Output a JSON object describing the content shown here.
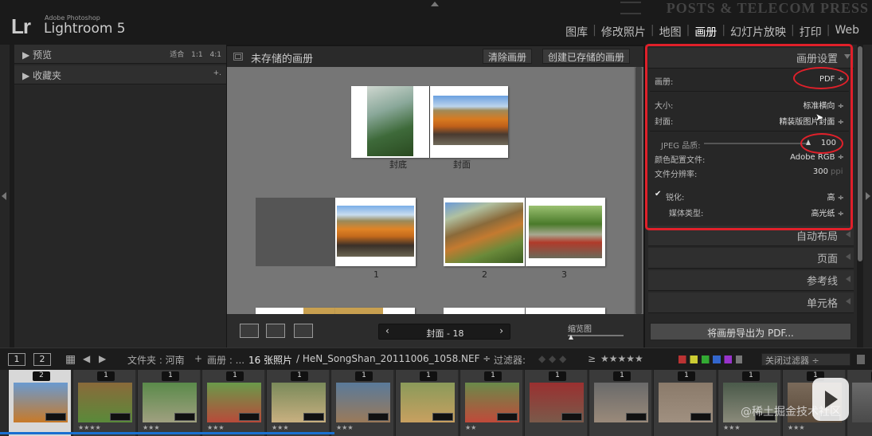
{
  "app": {
    "logo": "Lr",
    "vendor": "Adobe Photoshop",
    "name": "Lightroom 5",
    "watermark_top": "POSTS & TELECOM PRESS"
  },
  "modules": [
    "图库",
    "修改照片",
    "地图",
    "画册",
    "幻灯片放映",
    "打印",
    "Web"
  ],
  "active_module": "画册",
  "left_panel": {
    "preview": {
      "label": "预览",
      "zoom_options": [
        "适合",
        "1:1",
        "4:1"
      ]
    },
    "collections": {
      "label": "收藏夹",
      "action": "+."
    }
  },
  "center": {
    "title": "未存储的画册",
    "clear_button": "清除画册",
    "create_button": "创建已存储的画册",
    "spread_labels": {
      "back": "封底",
      "front": "封面",
      "p1": "1",
      "p2": "2",
      "p3": "3"
    },
    "page_nav_label": "封面 - 18",
    "zoom_label": "缩览图"
  },
  "right_panel": {
    "book_settings": {
      "title": "画册设置",
      "book_label": "画册:",
      "book_value": "PDF ÷",
      "size_label": "大小:",
      "size_value": "标准横向 ÷",
      "cover_label": "封面:",
      "cover_value": "精装版图片封面 ÷",
      "jpeg_label": "JPEG 品质:",
      "jpeg_value": "100",
      "jpeg_quality": 100,
      "color_profile_label": "颜色配置文件:",
      "color_profile_value": "Adobe RGB ÷",
      "resolution_label": "文件分辨率:",
      "resolution_value": "300",
      "resolution_unit": "ppi",
      "sharpen_label": "锐化:",
      "sharpen_value": "高 ÷",
      "media_label": "媒体类型:",
      "media_value": "高光纸 ÷"
    },
    "sections": [
      "自动布局",
      "页面",
      "参考线",
      "单元格"
    ],
    "export_button": "将画册导出为 PDF..."
  },
  "filmstrip_bar": {
    "view1": "1",
    "view2": "2",
    "folder_label": "文件夹 : 河南",
    "book_label": "画册 : ...",
    "count": "16 张照片",
    "filename": "/ HeN_SongShan_20111006_1058.NEF ÷",
    "filter_label": "过滤器:",
    "filter_stars": "★★★★★",
    "filter_value": "关闭过滤器 ÷"
  },
  "filmstrip": [
    {
      "num": "2",
      "dots": "",
      "colors": [
        "#6a9ad0",
        "#c87a28"
      ]
    },
    {
      "num": "1",
      "dots": "★★★★",
      "colors": [
        "#8a6a3a",
        "#5a8a3a"
      ]
    },
    {
      "num": "1",
      "dots": "★★★",
      "colors": [
        "#5a8a4a",
        "#a0a080"
      ]
    },
    {
      "num": "1",
      "dots": "★★★",
      "colors": [
        "#6a9a4a",
        "#b84a3a"
      ]
    },
    {
      "num": "1",
      "dots": "★★★",
      "colors": [
        "#7a8a5a",
        "#c8b080"
      ]
    },
    {
      "num": "1",
      "dots": "★★★",
      "colors": [
        "#5a7a9a",
        "#9a7a5a"
      ]
    },
    {
      "num": "1",
      "dots": "",
      "colors": [
        "#8a9a5a",
        "#c8a060"
      ]
    },
    {
      "num": "1",
      "dots": "★★",
      "colors": [
        "#6a8a4a",
        "#c04a3a"
      ]
    },
    {
      "num": "1",
      "dots": "",
      "colors": [
        "#9a3030",
        "#7a5a4a"
      ]
    },
    {
      "num": "1",
      "dots": "",
      "colors": [
        "#6a6a6a",
        "#9a8a7a"
      ]
    },
    {
      "num": "1",
      "dots": "",
      "colors": [
        "#8a7a6a",
        "#a09080"
      ]
    },
    {
      "num": "1",
      "dots": "★★★",
      "colors": [
        "#4a5a4a",
        "#8a8a7a"
      ]
    },
    {
      "num": "1",
      "dots": "★★★",
      "colors": [
        "#7a6a5a",
        "#5a4a3a"
      ]
    },
    {
      "num": "1",
      "dots": "",
      "colors": [
        "#6a6a6a",
        "#4a4a4a"
      ]
    }
  ],
  "watermark_bottom": "@稀土掘金技术社区"
}
